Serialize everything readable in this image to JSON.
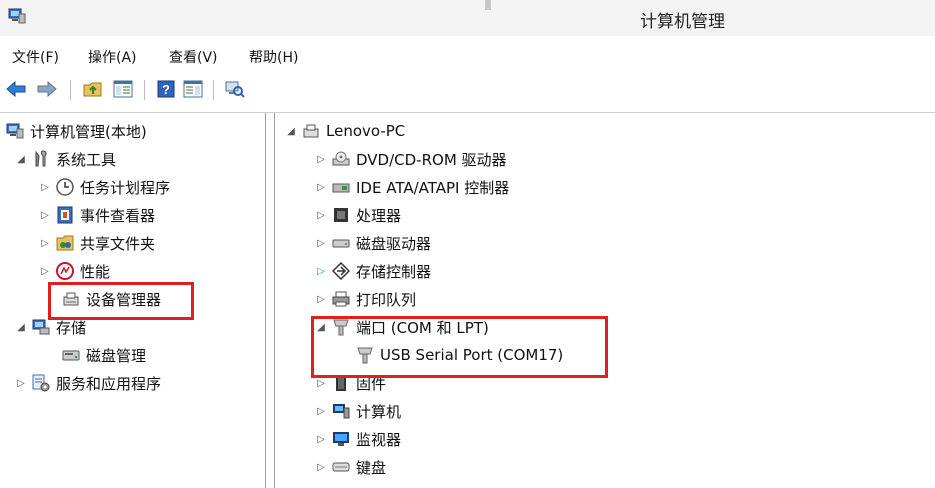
{
  "window": {
    "title": "计算机管理"
  },
  "menu": [
    {
      "label": "文件(F)"
    },
    {
      "label": "操作(A)"
    },
    {
      "label": "查看(V)"
    },
    {
      "label": "帮助(H)"
    }
  ],
  "toolbar": {
    "buttons": [
      {
        "icon": "back-arrow-icon"
      },
      {
        "icon": "forward-arrow-icon"
      },
      {
        "icon": "up-folder-icon"
      },
      {
        "icon": "show-hide-console-tree-icon"
      },
      {
        "icon": "help-icon"
      },
      {
        "icon": "show-action-pane-icon"
      },
      {
        "icon": "scan-hardware-icon"
      }
    ]
  },
  "left_tree": {
    "root": {
      "label": "计算机管理(本地)"
    },
    "system_tools": {
      "label": "系统工具"
    },
    "task_scheduler": {
      "label": "任务计划程序"
    },
    "event_viewer": {
      "label": "事件查看器"
    },
    "shared_folders": {
      "label": "共享文件夹"
    },
    "performance": {
      "label": "性能"
    },
    "device_manager": {
      "label": "设备管理器"
    },
    "storage": {
      "label": "存储"
    },
    "disk_management": {
      "label": "磁盘管理"
    },
    "services_apps": {
      "label": "服务和应用程序"
    }
  },
  "device_tree": {
    "computer": {
      "label": "Lenovo-PC"
    },
    "items": [
      {
        "label": "DVD/CD-ROM 驱动器",
        "icon": "dvd-drive-icon"
      },
      {
        "label": "IDE ATA/ATAPI 控制器",
        "icon": "ide-controller-icon"
      },
      {
        "label": "处理器",
        "icon": "processor-icon"
      },
      {
        "label": "磁盘驱动器",
        "icon": "disk-drive-icon"
      },
      {
        "label": "存储控制器",
        "icon": "storage-controller-icon"
      },
      {
        "label": "打印队列",
        "icon": "printer-icon"
      },
      {
        "label": "端口 (COM 和 LPT)",
        "icon": "port-icon"
      },
      {
        "label": "USB Serial Port (COM17)",
        "icon": "port-icon"
      },
      {
        "label": "固件",
        "icon": "firmware-icon"
      },
      {
        "label": "计算机",
        "icon": "computer-icon"
      },
      {
        "label": "监视器",
        "icon": "monitor-icon"
      },
      {
        "label": "键盘",
        "icon": "keyboard-icon"
      }
    ]
  },
  "colors": {
    "highlight": "#e0201c",
    "expand_arrow_active": "#1a8ad4"
  }
}
